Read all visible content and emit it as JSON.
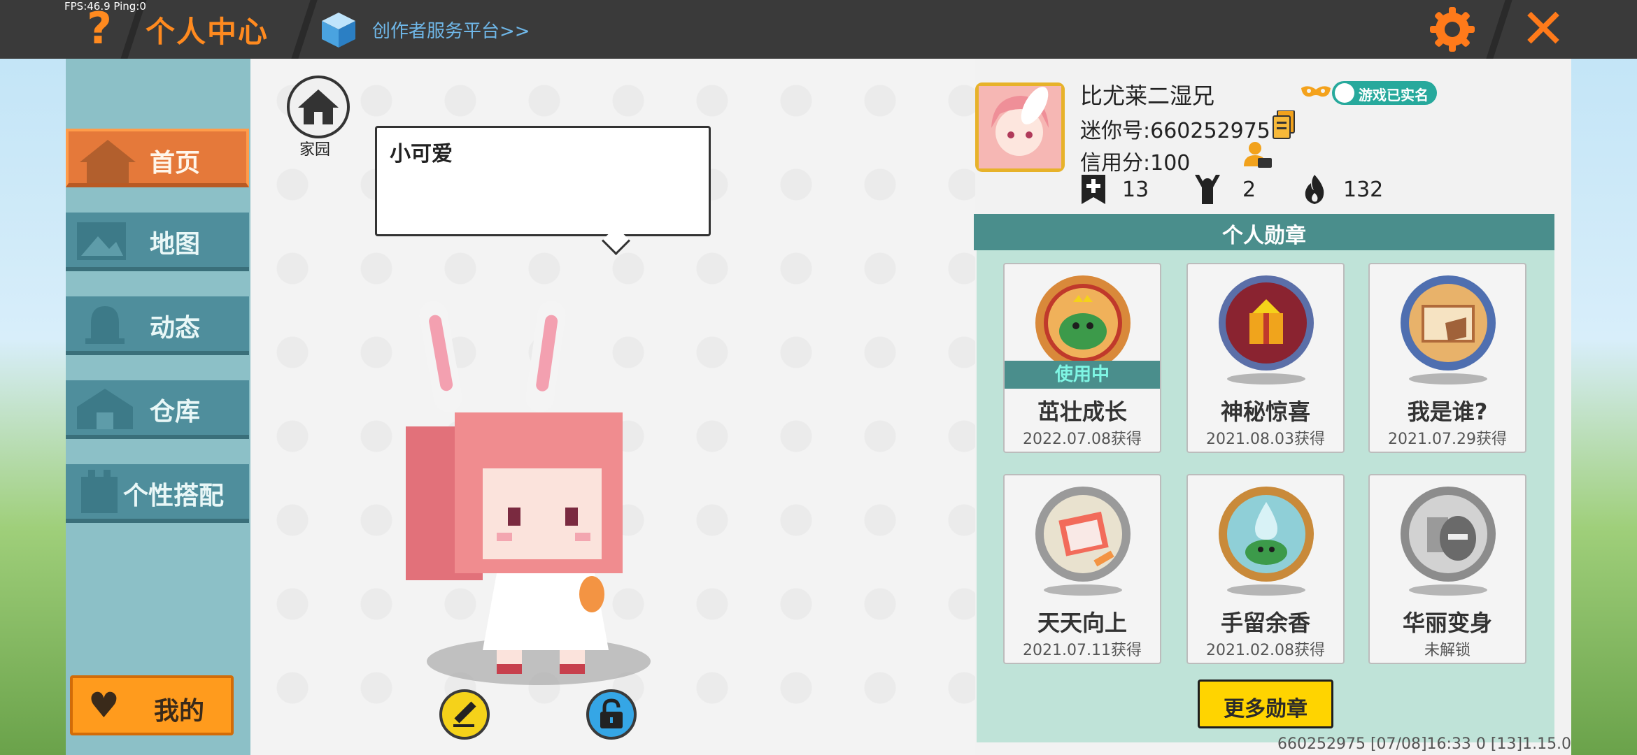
{
  "topbar": {
    "fps_text": "FPS:46.9  Ping:0",
    "help_glyph": "?",
    "title": "个人中心",
    "creator_link": "创作者服务平台>>",
    "close_glyph": "✕",
    "icons": [
      "help-icon",
      "cube-icon",
      "gear-icon",
      "close-icon"
    ]
  },
  "sidebar": {
    "items": [
      {
        "label": "首页",
        "active": true,
        "icon": "home-icon"
      },
      {
        "label": "地图",
        "active": false,
        "icon": "map-icon"
      },
      {
        "label": "动态",
        "active": false,
        "icon": "bell-icon"
      },
      {
        "label": "仓库",
        "active": false,
        "icon": "warehouse-icon"
      },
      {
        "label": "个性搭配",
        "active": false,
        "icon": "outfit-icon"
      }
    ],
    "mine_button": {
      "label": "我的",
      "icon": "heart-icon"
    }
  },
  "center": {
    "home_label": "家园",
    "bubble_text": "小可爱",
    "buttons": [
      "edit-icon",
      "lock-icon"
    ]
  },
  "profile": {
    "nickname": "比尤莱二湿兄",
    "realname_badge": "游戏已实名",
    "mini_id": "迷你号:660252975",
    "credit": "信用分:100",
    "stats": [
      {
        "icon": "bookmark-plus-icon",
        "value": "13"
      },
      {
        "icon": "cheer-icon",
        "value": "2"
      },
      {
        "icon": "fire-icon",
        "value": "132"
      }
    ]
  },
  "medals": {
    "header": "个人勋章",
    "in_use_label": "使用中",
    "items": [
      {
        "name": "茁壮成长",
        "date": "2022.07.08获得",
        "in_use": true
      },
      {
        "name": "神秘惊喜",
        "date": "2021.08.03获得",
        "in_use": false
      },
      {
        "name": "我是谁?",
        "date": "2021.07.29获得",
        "in_use": false
      },
      {
        "name": "天天向上",
        "date": "2021.07.11获得",
        "in_use": false
      },
      {
        "name": "手留余香",
        "date": "2021.02.08获得",
        "in_use": false
      },
      {
        "name": "华丽变身",
        "date": "未解锁",
        "in_use": false
      }
    ],
    "more_button": "更多勋章"
  },
  "footer": {
    "info": "660252975   [07/08]16:33 0  [13]1.15.0"
  },
  "colors": {
    "accent_orange": "#ff8a1f",
    "teal": "#4a8e8c",
    "nav_blue": "#4f8e9c",
    "yellow_button": "#ffd400"
  }
}
